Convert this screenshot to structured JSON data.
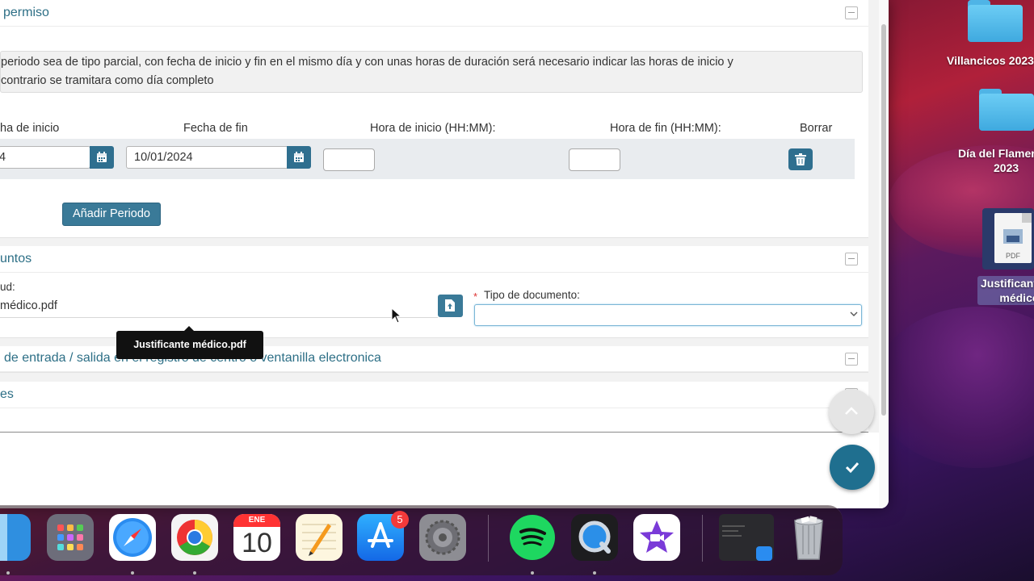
{
  "desktop": {
    "items": [
      {
        "label": "Villancicos 2023"
      },
      {
        "label_line1": "Día del Flamenco",
        "label_line2": "2023"
      },
      {
        "label_line1": "Justificante",
        "label_line2": "médico",
        "file_type": "PDF"
      }
    ]
  },
  "form": {
    "periods_panel": {
      "title": "permiso",
      "info_line1": "periodo sea de tipo parcial, con fecha de inicio y fin en el mismo día y con unas horas de duración será necesario indicar las horas de inicio y",
      "info_line2": "contrario se tramitara como día completo",
      "columns": {
        "start_date": "ha de inicio",
        "end_date": "Fecha de fin",
        "start_time": "Hora de inicio (HH:MM):",
        "end_time": "Hora de fin (HH:MM):",
        "delete": "Borrar"
      },
      "row": {
        "start_date": "4",
        "end_date": "10/01/2024",
        "start_time": "",
        "end_time": ""
      },
      "add_button": "Añadir Periodo"
    },
    "documents_panel": {
      "title": "untos",
      "file_label": "ud:",
      "file_value": "médico.pdf",
      "doc_type_required_mark": "*",
      "doc_type_label": "Tipo de documento:",
      "doc_type_value": "",
      "tooltip": "Justificante médico.pdf"
    },
    "registry_panel": {
      "title": "de entrada / salida en el registro de centro o ventanilla electronica"
    },
    "notes_panel": {
      "title": "es"
    }
  },
  "dock": {
    "calendar_month": "ENE",
    "calendar_day": "10",
    "app_store_badge": "5"
  }
}
